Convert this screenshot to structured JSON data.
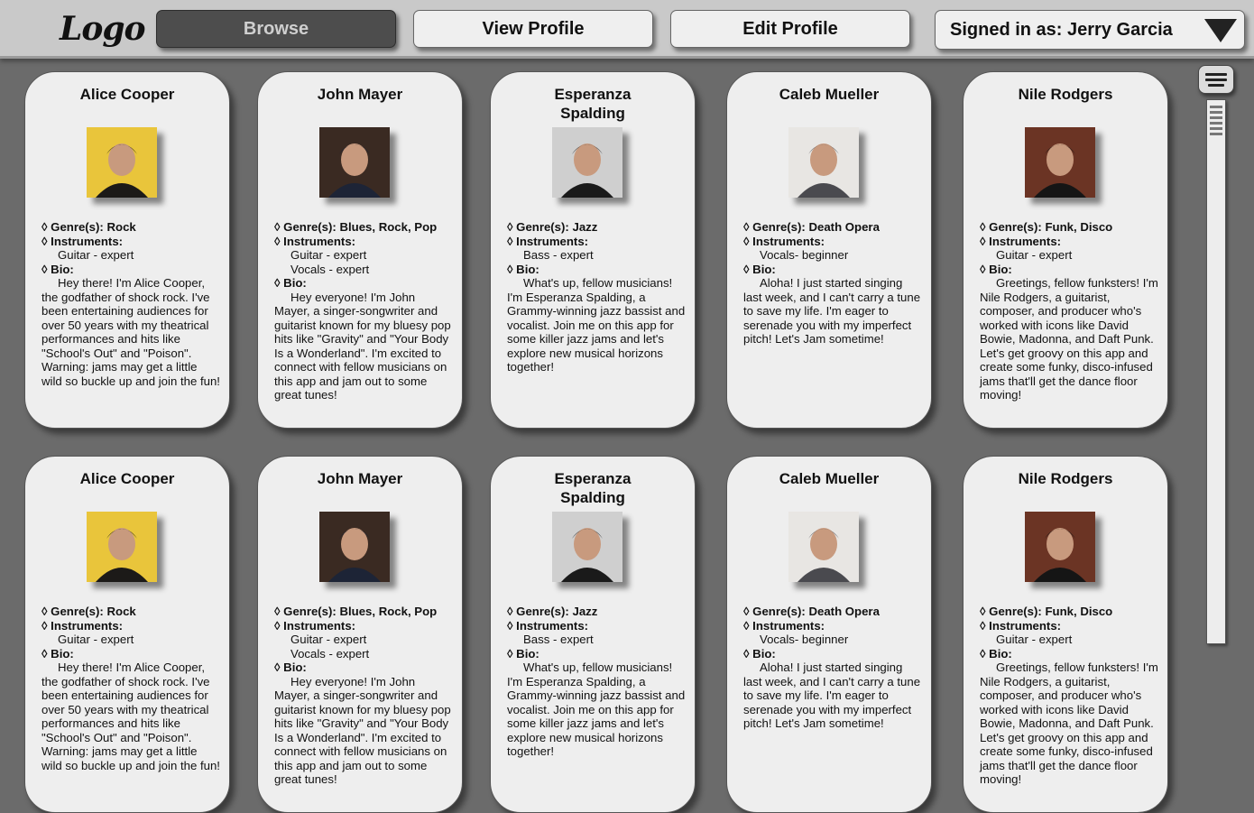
{
  "header": {
    "logo": "Logo",
    "nav": {
      "browse": "Browse",
      "view_profile": "View Profile",
      "edit_profile": "Edit Profile"
    },
    "signed_in": "Signed in as: Jerry Garcia"
  },
  "labels": {
    "genres": "◊ Genre(s):",
    "instruments": "◊ Instruments:",
    "bio": "◊ Bio:"
  },
  "musicians": [
    {
      "name": "Alice Cooper",
      "genres": "Rock",
      "instruments": [
        "Guitar - expert"
      ],
      "bio": "Hey there! I'm Alice Cooper, the godfather of shock rock. I've been entertaining audiences for over 50 years with my theatrical performances and hits like \"School's Out\" and \"Poison\". Warning: jams may get a little wild so buckle up and join the fun!",
      "photo_bg": "#e9c53b",
      "photo_fg": "#1c1a18"
    },
    {
      "name": "John Mayer",
      "genres": "Blues, Rock, Pop",
      "instruments": [
        "Guitar - expert",
        "Vocals - expert"
      ],
      "bio": "Hey everyone! I'm John Mayer, a singer-songwriter and guitarist known for my bluesy pop hits like \"Gravity\" and \"Your Body Is a Wonderland\". I'm excited to connect with fellow musicians on this app and jam out to some great tunes!",
      "photo_bg": "#3a2a22",
      "photo_fg": "#1d2436"
    },
    {
      "name": "Esperanza Spalding",
      "genres": "Jazz",
      "instruments": [
        "Bass - expert"
      ],
      "bio": "What's up, fellow musicians! I'm Esperanza Spalding, a Grammy-winning jazz bassist and vocalist. Join me on this app for some killer jazz jams and let's explore new musical horizons together!",
      "photo_bg": "#cfcfcf",
      "photo_fg": "#1a1a1a"
    },
    {
      "name": "Caleb Mueller",
      "genres": "Death Opera",
      "instruments": [
        "Vocals- beginner"
      ],
      "bio": "Aloha!  I just started singing last week, and I can't carry a tune to save my life.  I'm eager to serenade you with my imperfect pitch!  Let's Jam sometime!",
      "photo_bg": "#e8e6e3",
      "photo_fg": "#4a4a4f"
    },
    {
      "name": "Nile Rodgers",
      "genres": "Funk, Disco",
      "instruments": [
        "Guitar - expert"
      ],
      "bio": "Greetings, fellow funksters! I'm Nile Rodgers, a guitarist, composer, and producer who's worked with icons like David Bowie, Madonna, and Daft Punk. Let's get groovy on this app and create some funky, disco-infused jams that'll get the dance floor moving!",
      "photo_bg": "#6b3424",
      "photo_fg": "#151515"
    }
  ]
}
